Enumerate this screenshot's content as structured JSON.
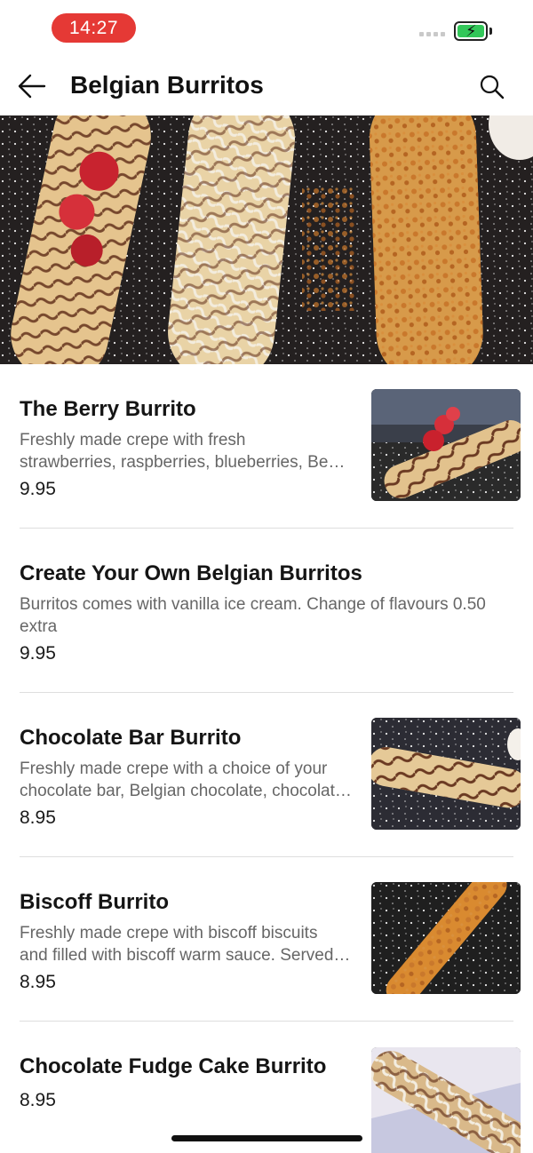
{
  "status_bar": {
    "time": "14:27"
  },
  "header": {
    "title": "Belgian Burritos"
  },
  "icons": {
    "back": "arrow-left-icon",
    "search": "search-icon",
    "battery": "battery-charging-icon"
  },
  "colors": {
    "accent": "#e53935",
    "battery": "#32c759"
  },
  "items": [
    {
      "name": "The Berry Burrito",
      "desc_lines": [
        "Freshly made crepe with fresh",
        "strawberries, raspberries, blueberries, Be…"
      ],
      "price": "9.95",
      "has_image": true
    },
    {
      "name": "Create Your Own Belgian Burritos",
      "desc_lines": [
        "Burritos comes with vanilla ice cream. Change of flavours 0.50",
        "extra"
      ],
      "price": "9.95",
      "has_image": false
    },
    {
      "name": "Chocolate Bar Burrito",
      "desc_lines": [
        "Freshly made crepe with a choice of your",
        "chocolate bar, Belgian chocolate, chocolat…"
      ],
      "price": "8.95",
      "has_image": true
    },
    {
      "name": "Biscoff Burrito",
      "desc_lines": [
        "Freshly made crepe with biscoff biscuits",
        "and filled with biscoff warm sauce. Served…"
      ],
      "price": "8.95",
      "has_image": true
    },
    {
      "name": "Chocolate Fudge Cake Burrito",
      "desc_lines": [],
      "price": "8.95",
      "has_image": true
    }
  ]
}
